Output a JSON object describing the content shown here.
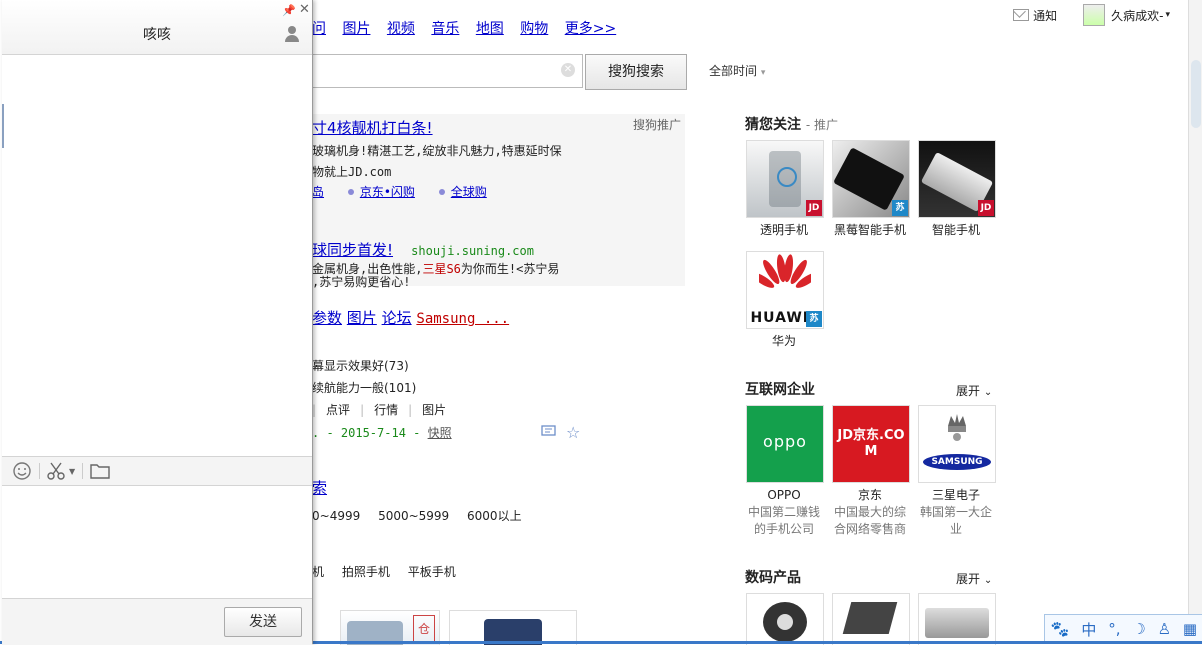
{
  "nav": {
    "items": [
      "问",
      "图片",
      "视频",
      "音乐",
      "地图",
      "购物",
      "更多>>"
    ]
  },
  "user": {
    "notify": "通知",
    "name": "久病成欢-"
  },
  "search": {
    "button": "搜狗搜索",
    "time_filter": "全部时间"
  },
  "ads": {
    "promo_tag": "搜狗推广",
    "ad1_title": "寸4核靓机打白条!",
    "ad1_line1": "玻璃机身!精湛工艺,绽放非凡魅力,特惠延时保",
    "ad1_line2": "物就上JD.com",
    "ad1_links": [
      "岛",
      "京东•闪购",
      "全球购"
    ],
    "ad2_title": "球同步首发!",
    "ad2_url": "shouji.suning.com",
    "ad2_line1_a": "金属机身,出色性能,",
    "ad2_line1_red": "三星S6",
    "ad2_line1_b": "为你而生!<苏宁易",
    "ad2_line2": ",苏宁易购更省心!"
  },
  "result1": {
    "title_a": "参数",
    "title_b": "图片",
    "title_c": "论坛",
    "title_red": "Samsung ...",
    "review1": "幕显示效果好(73)",
    "review2": "续航能力一般(101)",
    "tabs": [
      "点评",
      "行情",
      "图片"
    ],
    "date_line": ". - 2015-7-14 - ",
    "snapshot": "快照"
  },
  "result2": {
    "title": "索",
    "prices": [
      "0~4999",
      "5000~5999",
      "6000以上"
    ],
    "types": [
      "机",
      "拍照手机",
      "平板手机"
    ]
  },
  "right": {
    "guess_title": "猜您关注",
    "guess_sub": "推广",
    "guess_items": [
      "透明手机",
      "黑莓智能手机",
      "智能手机",
      "华为"
    ],
    "huawei_logo": "HUAWEI",
    "internet_title": "互联网企业",
    "expand": "展开",
    "companies": [
      {
        "name": "OPPO",
        "desc": "中国第二赚钱的手机公司",
        "logo": "oppo"
      },
      {
        "name": "京东",
        "desc": "中国最大的综合网络零售商",
        "logo": "JD京东.COM"
      },
      {
        "name": "三星电子",
        "desc": "韩国第一大企业",
        "logo": "SAMSUNG"
      }
    ],
    "digital_title": "数码产品"
  },
  "chat": {
    "title": "咳咳",
    "send": "发送"
  },
  "ime": {
    "lang": "中"
  }
}
